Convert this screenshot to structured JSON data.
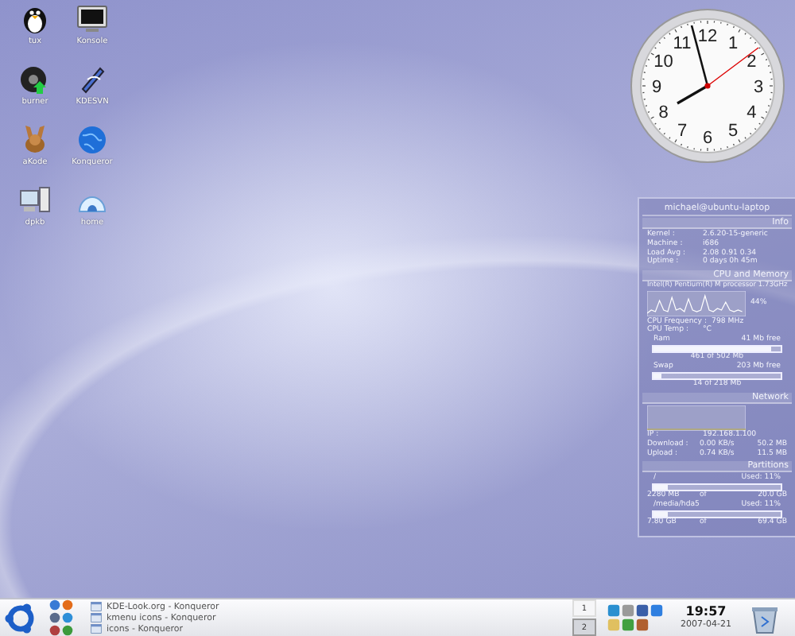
{
  "desktop_icons": [
    {
      "label": "tux",
      "kind": "penguin"
    },
    {
      "label": "Konsole",
      "kind": "monitor"
    },
    {
      "label": "burner",
      "kind": "disc"
    },
    {
      "label": "KDESVN",
      "kind": "tool"
    },
    {
      "label": "aKode",
      "kind": "rabbit"
    },
    {
      "label": "Konqueror",
      "kind": "globe"
    },
    {
      "label": "dpkb",
      "kind": "computer"
    },
    {
      "label": "home",
      "kind": "igloo"
    }
  ],
  "clock": {
    "numerals": [
      "12",
      "11",
      "1",
      "10",
      "2",
      "9",
      "3",
      "8",
      "4",
      "7",
      "5",
      "6"
    ]
  },
  "sysinfo": {
    "host": "michael@ubuntu-laptop",
    "sections": [
      {
        "title": "Info",
        "items": [
          {
            "kind": "kv",
            "label": "Kernel :",
            "value": "2.6.20-15-generic"
          },
          {
            "kind": "kv",
            "label": "Machine :",
            "value": "i686"
          },
          {
            "kind": "kv",
            "label": "Load Avg :",
            "value": "2.08  0.91  0.34"
          },
          {
            "kind": "kv",
            "label": "Uptime :",
            "value": "0 days  0h  45m"
          }
        ]
      },
      {
        "title": "CPU and Memory",
        "items": [
          {
            "kind": "line",
            "text": "Intel(R) Pentium(R) M processor 1.73GHz"
          },
          {
            "kind": "graph",
            "reading": "44%"
          },
          {
            "kind": "kv",
            "label": "CPU Frequency :",
            "value": "798 MHz"
          },
          {
            "kind": "kv",
            "label": "CPU Temp :",
            "value": "°C"
          },
          {
            "kind": "split",
            "left": "Ram",
            "right": "41 Mb free"
          },
          {
            "kind": "bar",
            "level": 0.92
          },
          {
            "kind": "center",
            "text": "461 of 502 Mb"
          },
          {
            "kind": "split",
            "left": "Swap",
            "right": "203 Mb free"
          },
          {
            "kind": "bar",
            "level": 0.06
          },
          {
            "kind": "center",
            "text": "14 of 218 Mb"
          }
        ]
      },
      {
        "title": "Network",
        "items": [
          {
            "kind": "graph"
          },
          {
            "kind": "kv",
            "label": "IP :",
            "value": "192.168.1.100"
          },
          {
            "kind": "kv3",
            "label": "Download :",
            "value": "0.00 KB/s",
            "extra": "50.2 MB"
          },
          {
            "kind": "kv3",
            "label": "Upload :",
            "value": "0.74 KB/s",
            "extra": "11.5 MB"
          }
        ]
      },
      {
        "title": "Partitions",
        "items": [
          {
            "kind": "split",
            "left": "/",
            "right": "Used: 11%"
          },
          {
            "kind": "bar",
            "level": 0.11
          },
          {
            "kind": "kv3",
            "label": "2280 MB",
            "value": "of",
            "extra": "20.0 GB"
          },
          {
            "kind": "split",
            "left": "/media/hda5",
            "right": "Used: 11%"
          },
          {
            "kind": "bar",
            "level": 0.11
          },
          {
            "kind": "kv3",
            "label": "7.80 GB",
            "value": "of",
            "extra": "69.4 GB"
          }
        ]
      }
    ]
  },
  "taskbar": {
    "tasks": [
      {
        "label": "KDE-Look.org - Konqueror",
        "selected": false
      },
      {
        "label": "kmenu icons - Konqueror",
        "selected": false
      },
      {
        "label": "icons - Konqueror",
        "selected": false
      }
    ],
    "pager": [
      {
        "label": "1",
        "selected": false
      },
      {
        "label": "2",
        "selected": true
      }
    ],
    "time": "19:57",
    "date": "2007-04-21"
  }
}
